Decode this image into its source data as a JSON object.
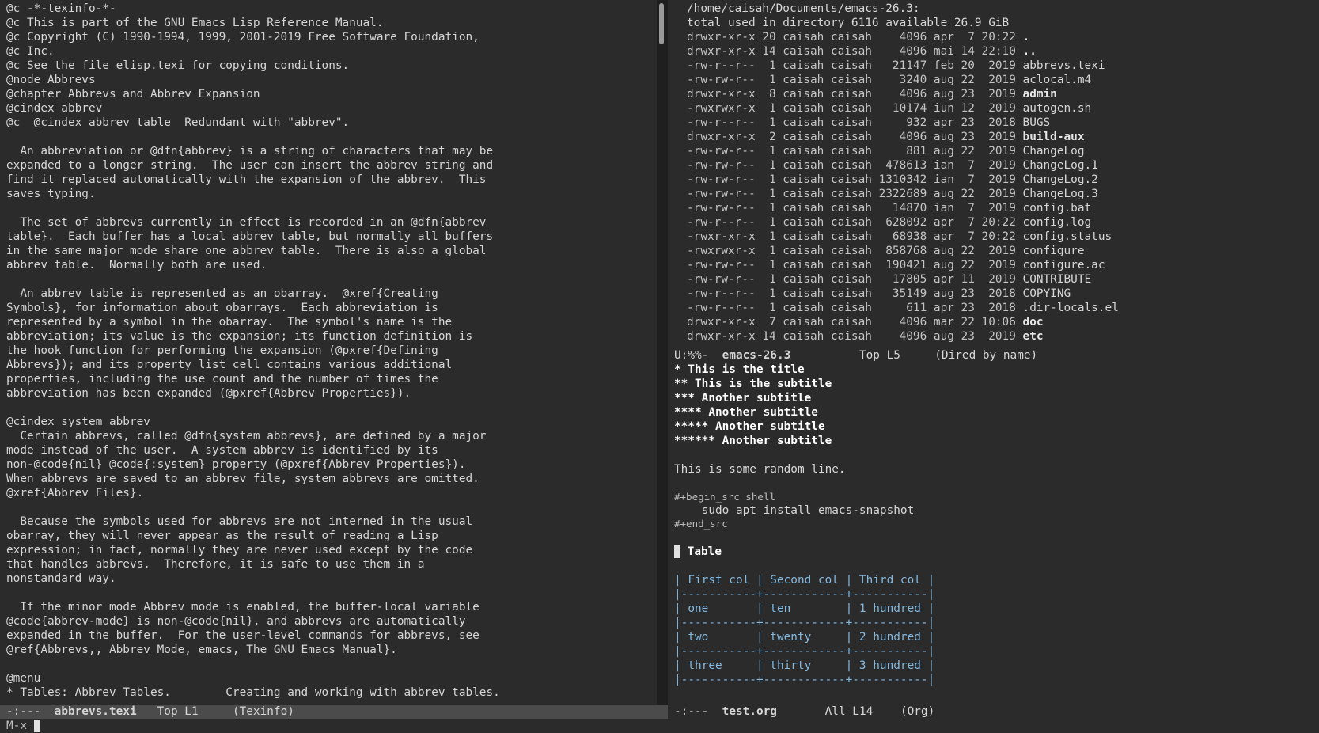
{
  "left_buffer": {
    "lines": [
      "@c -*-texinfo-*-",
      "@c This is part of the GNU Emacs Lisp Reference Manual.",
      "@c Copyright (C) 1990-1994, 1999, 2001-2019 Free Software Foundation,",
      "@c Inc.",
      "@c See the file elisp.texi for copying conditions.",
      "@node Abbrevs",
      "@chapter Abbrevs and Abbrev Expansion",
      "@cindex abbrev",
      "@c  @cindex abbrev table  Redundant with \"abbrev\".",
      "",
      "  An abbreviation or @dfn{abbrev} is a string of characters that may be",
      "expanded to a longer string.  The user can insert the abbrev string and",
      "find it replaced automatically with the expansion of the abbrev.  This",
      "saves typing.",
      "",
      "  The set of abbrevs currently in effect is recorded in an @dfn{abbrev",
      "table}.  Each buffer has a local abbrev table, but normally all buffers",
      "in the same major mode share one abbrev table.  There is also a global",
      "abbrev table.  Normally both are used.",
      "",
      "  An abbrev table is represented as an obarray.  @xref{Creating",
      "Symbols}, for information about obarrays.  Each abbreviation is",
      "represented by a symbol in the obarray.  The symbol's name is the",
      "abbreviation; its value is the expansion; its function definition is",
      "the hook function for performing the expansion (@pxref{Defining",
      "Abbrevs}); and its property list cell contains various additional",
      "properties, including the use count and the number of times the",
      "abbreviation has been expanded (@pxref{Abbrev Properties}).",
      "",
      "@cindex system abbrev",
      "  Certain abbrevs, called @dfn{system abbrevs}, are defined by a major",
      "mode instead of the user.  A system abbrev is identified by its",
      "non-@code{nil} @code{:system} property (@pxref{Abbrev Properties}).",
      "When abbrevs are saved to an abbrev file, system abbrevs are omitted.",
      "@xref{Abbrev Files}.",
      "",
      "  Because the symbols used for abbrevs are not interned in the usual",
      "obarray, they will never appear as the result of reading a Lisp",
      "expression; in fact, normally they are never used except by the code",
      "that handles abbrevs.  Therefore, it is safe to use them in a",
      "nonstandard way.",
      "",
      "  If the minor mode Abbrev mode is enabled, the buffer-local variable",
      "@code{abbrev-mode} is non-@code{nil}, and abbrevs are automatically",
      "expanded in the buffer.  For the user-level commands for abbrevs, see",
      "@ref{Abbrevs,, Abbrev Mode, emacs, The GNU Emacs Manual}.",
      "",
      "@menu",
      "* Tables: Abbrev Tables.        Creating and working with abbrev tables."
    ],
    "modeline": {
      "status": "-:---",
      "name": "abbrevs.texi",
      "position": "Top L1",
      "mode": "(Texinfo)"
    }
  },
  "dired": {
    "header": "/home/caisah/Documents/emacs-26.3:",
    "summary": "total used in directory 6116 available 26.9 GiB",
    "entries": [
      {
        "perm": "drwxr-xr-x",
        "links": "20",
        "owner": "caisah",
        "group": "caisah",
        "size": "4096",
        "date": "apr  7 20:22",
        "name": ".",
        "dir": true
      },
      {
        "perm": "drwxr-xr-x",
        "links": "14",
        "owner": "caisah",
        "group": "caisah",
        "size": "4096",
        "date": "mai 14 22:10",
        "name": "..",
        "dir": true
      },
      {
        "perm": "-rw-r--r--",
        "links": "1",
        "owner": "caisah",
        "group": "caisah",
        "size": "21147",
        "date": "feb 20  2019",
        "name": "abbrevs.texi",
        "dir": false
      },
      {
        "perm": "-rw-rw-r--",
        "links": "1",
        "owner": "caisah",
        "group": "caisah",
        "size": "3240",
        "date": "aug 22  2019",
        "name": "aclocal.m4",
        "dir": false
      },
      {
        "perm": "drwxr-xr-x",
        "links": "8",
        "owner": "caisah",
        "group": "caisah",
        "size": "4096",
        "date": "aug 23  2019",
        "name": "admin",
        "dir": true
      },
      {
        "perm": "-rwxrwxr-x",
        "links": "1",
        "owner": "caisah",
        "group": "caisah",
        "size": "10174",
        "date": "iun 12  2019",
        "name": "autogen.sh",
        "dir": false
      },
      {
        "perm": "-rw-r--r--",
        "links": "1",
        "owner": "caisah",
        "group": "caisah",
        "size": "932",
        "date": "apr 23  2018",
        "name": "BUGS",
        "dir": false
      },
      {
        "perm": "drwxr-xr-x",
        "links": "2",
        "owner": "caisah",
        "group": "caisah",
        "size": "4096",
        "date": "aug 23  2019",
        "name": "build-aux",
        "dir": true
      },
      {
        "perm": "-rw-rw-r--",
        "links": "1",
        "owner": "caisah",
        "group": "caisah",
        "size": "881",
        "date": "aug 22  2019",
        "name": "ChangeLog",
        "dir": false
      },
      {
        "perm": "-rw-rw-r--",
        "links": "1",
        "owner": "caisah",
        "group": "caisah",
        "size": "478613",
        "date": "ian  7  2019",
        "name": "ChangeLog.1",
        "dir": false
      },
      {
        "perm": "-rw-rw-r--",
        "links": "1",
        "owner": "caisah",
        "group": "caisah",
        "size": "1310342",
        "date": "ian  7  2019",
        "name": "ChangeLog.2",
        "dir": false
      },
      {
        "perm": "-rw-rw-r--",
        "links": "1",
        "owner": "caisah",
        "group": "caisah",
        "size": "2322689",
        "date": "aug 22  2019",
        "name": "ChangeLog.3",
        "dir": false
      },
      {
        "perm": "-rw-rw-r--",
        "links": "1",
        "owner": "caisah",
        "group": "caisah",
        "size": "14870",
        "date": "ian  7  2019",
        "name": "config.bat",
        "dir": false
      },
      {
        "perm": "-rw-r--r--",
        "links": "1",
        "owner": "caisah",
        "group": "caisah",
        "size": "628092",
        "date": "apr  7 20:22",
        "name": "config.log",
        "dir": false
      },
      {
        "perm": "-rwxr-xr-x",
        "links": "1",
        "owner": "caisah",
        "group": "caisah",
        "size": "68938",
        "date": "apr  7 20:22",
        "name": "config.status",
        "dir": false
      },
      {
        "perm": "-rwxrwxr-x",
        "links": "1",
        "owner": "caisah",
        "group": "caisah",
        "size": "858768",
        "date": "aug 22  2019",
        "name": "configure",
        "dir": false
      },
      {
        "perm": "-rw-rw-r--",
        "links": "1",
        "owner": "caisah",
        "group": "caisah",
        "size": "190421",
        "date": "aug 22  2019",
        "name": "configure.ac",
        "dir": false
      },
      {
        "perm": "-rw-rw-r--",
        "links": "1",
        "owner": "caisah",
        "group": "caisah",
        "size": "17805",
        "date": "apr 11  2019",
        "name": "CONTRIBUTE",
        "dir": false
      },
      {
        "perm": "-rw-r--r--",
        "links": "1",
        "owner": "caisah",
        "group": "caisah",
        "size": "35149",
        "date": "aug 23  2018",
        "name": "COPYING",
        "dir": false
      },
      {
        "perm": "-rw-r--r--",
        "links": "1",
        "owner": "caisah",
        "group": "caisah",
        "size": "611",
        "date": "apr 23  2018",
        "name": ".dir-locals.el",
        "dir": false
      },
      {
        "perm": "drwxr-xr-x",
        "links": "7",
        "owner": "caisah",
        "group": "caisah",
        "size": "4096",
        "date": "mar 22 10:06",
        "name": "doc",
        "dir": true
      },
      {
        "perm": "drwxr-xr-x",
        "links": "14",
        "owner": "caisah",
        "group": "caisah",
        "size": "4096",
        "date": "aug 23  2019",
        "name": "etc",
        "dir": true
      }
    ],
    "modeline": {
      "status": "U:%%-",
      "name": "emacs-26.3",
      "position": "Top L5",
      "mode": "(Dired by name)"
    }
  },
  "org": {
    "headings": [
      "* This is the title",
      "** This is the subtitle",
      "*** Another subtitle",
      "**** Another subtitle",
      "***** Another subtitle",
      "****** Another subtitle"
    ],
    "random_line": "This is some random line.",
    "src_begin": "#+begin_src shell",
    "src_body": "    sudo apt install emacs-snapshot",
    "src_end": "#+end_src",
    "table_heading": "* Table",
    "table_lines": [
      "| First col | Second col | Third col |",
      "|-----------+------------+-----------|",
      "| one       | ten        | 1 hundred |",
      "|-----------+------------+-----------|",
      "| two       | twenty     | 2 hundred |",
      "|-----------+------------+-----------|",
      "| three     | thirty     | 3 hundred |",
      "|-----------+------------+-----------|"
    ],
    "modeline": {
      "status": "-:---",
      "name": "test.org",
      "position": "All L14",
      "mode": "(Org)"
    }
  },
  "minibuffer": {
    "prompt": "M-x"
  }
}
